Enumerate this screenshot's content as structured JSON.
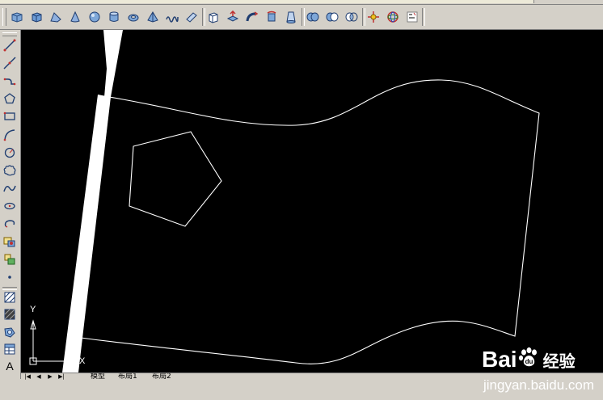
{
  "toolbar": {
    "icons": [
      "polysolid-icon",
      "box-icon",
      "wedge-icon",
      "cone-icon",
      "sphere-icon",
      "cylinder-icon",
      "torus-icon",
      "pyramid-icon",
      "helix-icon",
      "planar-surface-icon",
      "extrude-icon",
      "presspull-icon",
      "sweep-icon",
      "revolve-icon",
      "loft-icon",
      "union-icon",
      "subtract-icon",
      "intersect-icon",
      "3d-move-icon",
      "3d-rotate-icon",
      "3d-align-icon"
    ]
  },
  "left_toolbar": {
    "icons": [
      "line-icon",
      "construction-line-icon",
      "polyline-icon",
      "polygon-icon",
      "rectangle-icon",
      "arc-icon",
      "circle-icon",
      "revision-cloud-icon",
      "spline-icon",
      "ellipse-icon",
      "ellipse-arc-icon",
      "insert-block-icon",
      "make-block-icon",
      "point-icon",
      "hatch-icon",
      "gradient-icon",
      "region-icon",
      "table-icon"
    ],
    "text_tool_label": "A"
  },
  "ucs": {
    "x_label": "X",
    "y_label": "Y"
  },
  "tabs": {
    "model": "模型",
    "layout1": "布局1",
    "layout2": "布局2"
  },
  "watermark": {
    "brand_left": "Bai",
    "brand_right": "经验",
    "url": "jingyan.baidu.com"
  },
  "colors": {
    "canvas_bg": "#000000",
    "stroke": "#ffffff",
    "ui_bg": "#d4d0c8"
  }
}
